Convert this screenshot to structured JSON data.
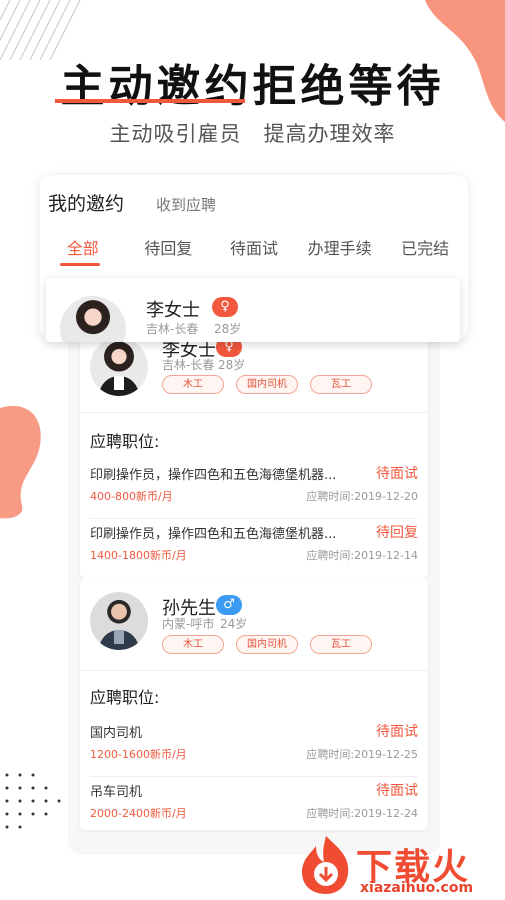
{
  "headline": "主动邀约拒绝等待",
  "subline": "主动吸引雇员　提高办理效率",
  "tab_card": {
    "title": "我的邀约",
    "subtitle": "收到应聘",
    "tabs": [
      "全部",
      "待回复",
      "待面试",
      "办理手续",
      "已完结"
    ],
    "active_tab": "全部"
  },
  "floating_card": {
    "name": "李女士",
    "gender": "♀",
    "location": "吉林-长春",
    "age": "28岁"
  },
  "applicants": [
    {
      "name": "李女士",
      "gender": "♀",
      "location": "吉林-长春",
      "age": "28岁",
      "tags": [
        "木工",
        "国内司机",
        "瓦工"
      ],
      "section_title": "应聘职位:",
      "jobs": [
        {
          "title": "印刷操作员，操作四色和五色海德堡机器...",
          "status": "待面试",
          "salary": "400-800新币/月",
          "time": "应聘时间:2019-12-20"
        },
        {
          "title": "印刷操作员，操作四色和五色海德堡机器...",
          "status": "待回复",
          "salary": "1400-1800新币/月",
          "time": "应聘时间:2019-12-14"
        }
      ]
    },
    {
      "name": "孙先生",
      "gender": "♂",
      "location": "内蒙-呼市",
      "age": "24岁",
      "tags": [
        "木工",
        "国内司机",
        "瓦工"
      ],
      "section_title": "应聘职位:",
      "jobs": [
        {
          "title": "国内司机",
          "status": "待面试",
          "salary": "1200-1600新币/月",
          "time": "应聘时间:2019-12-25"
        },
        {
          "title": "吊车司机",
          "status": "待面试",
          "salary": "2000-2400新币/月",
          "time": "应聘时间:2019-12-24"
        }
      ]
    }
  ],
  "logo": {
    "cn": "下载火",
    "en": "xiazaihuo.com"
  },
  "colors": {
    "accent": "#f2583e",
    "female_badge": "#f2583e",
    "male_badge": "#3a9bf0",
    "blob": "#f78a70"
  }
}
